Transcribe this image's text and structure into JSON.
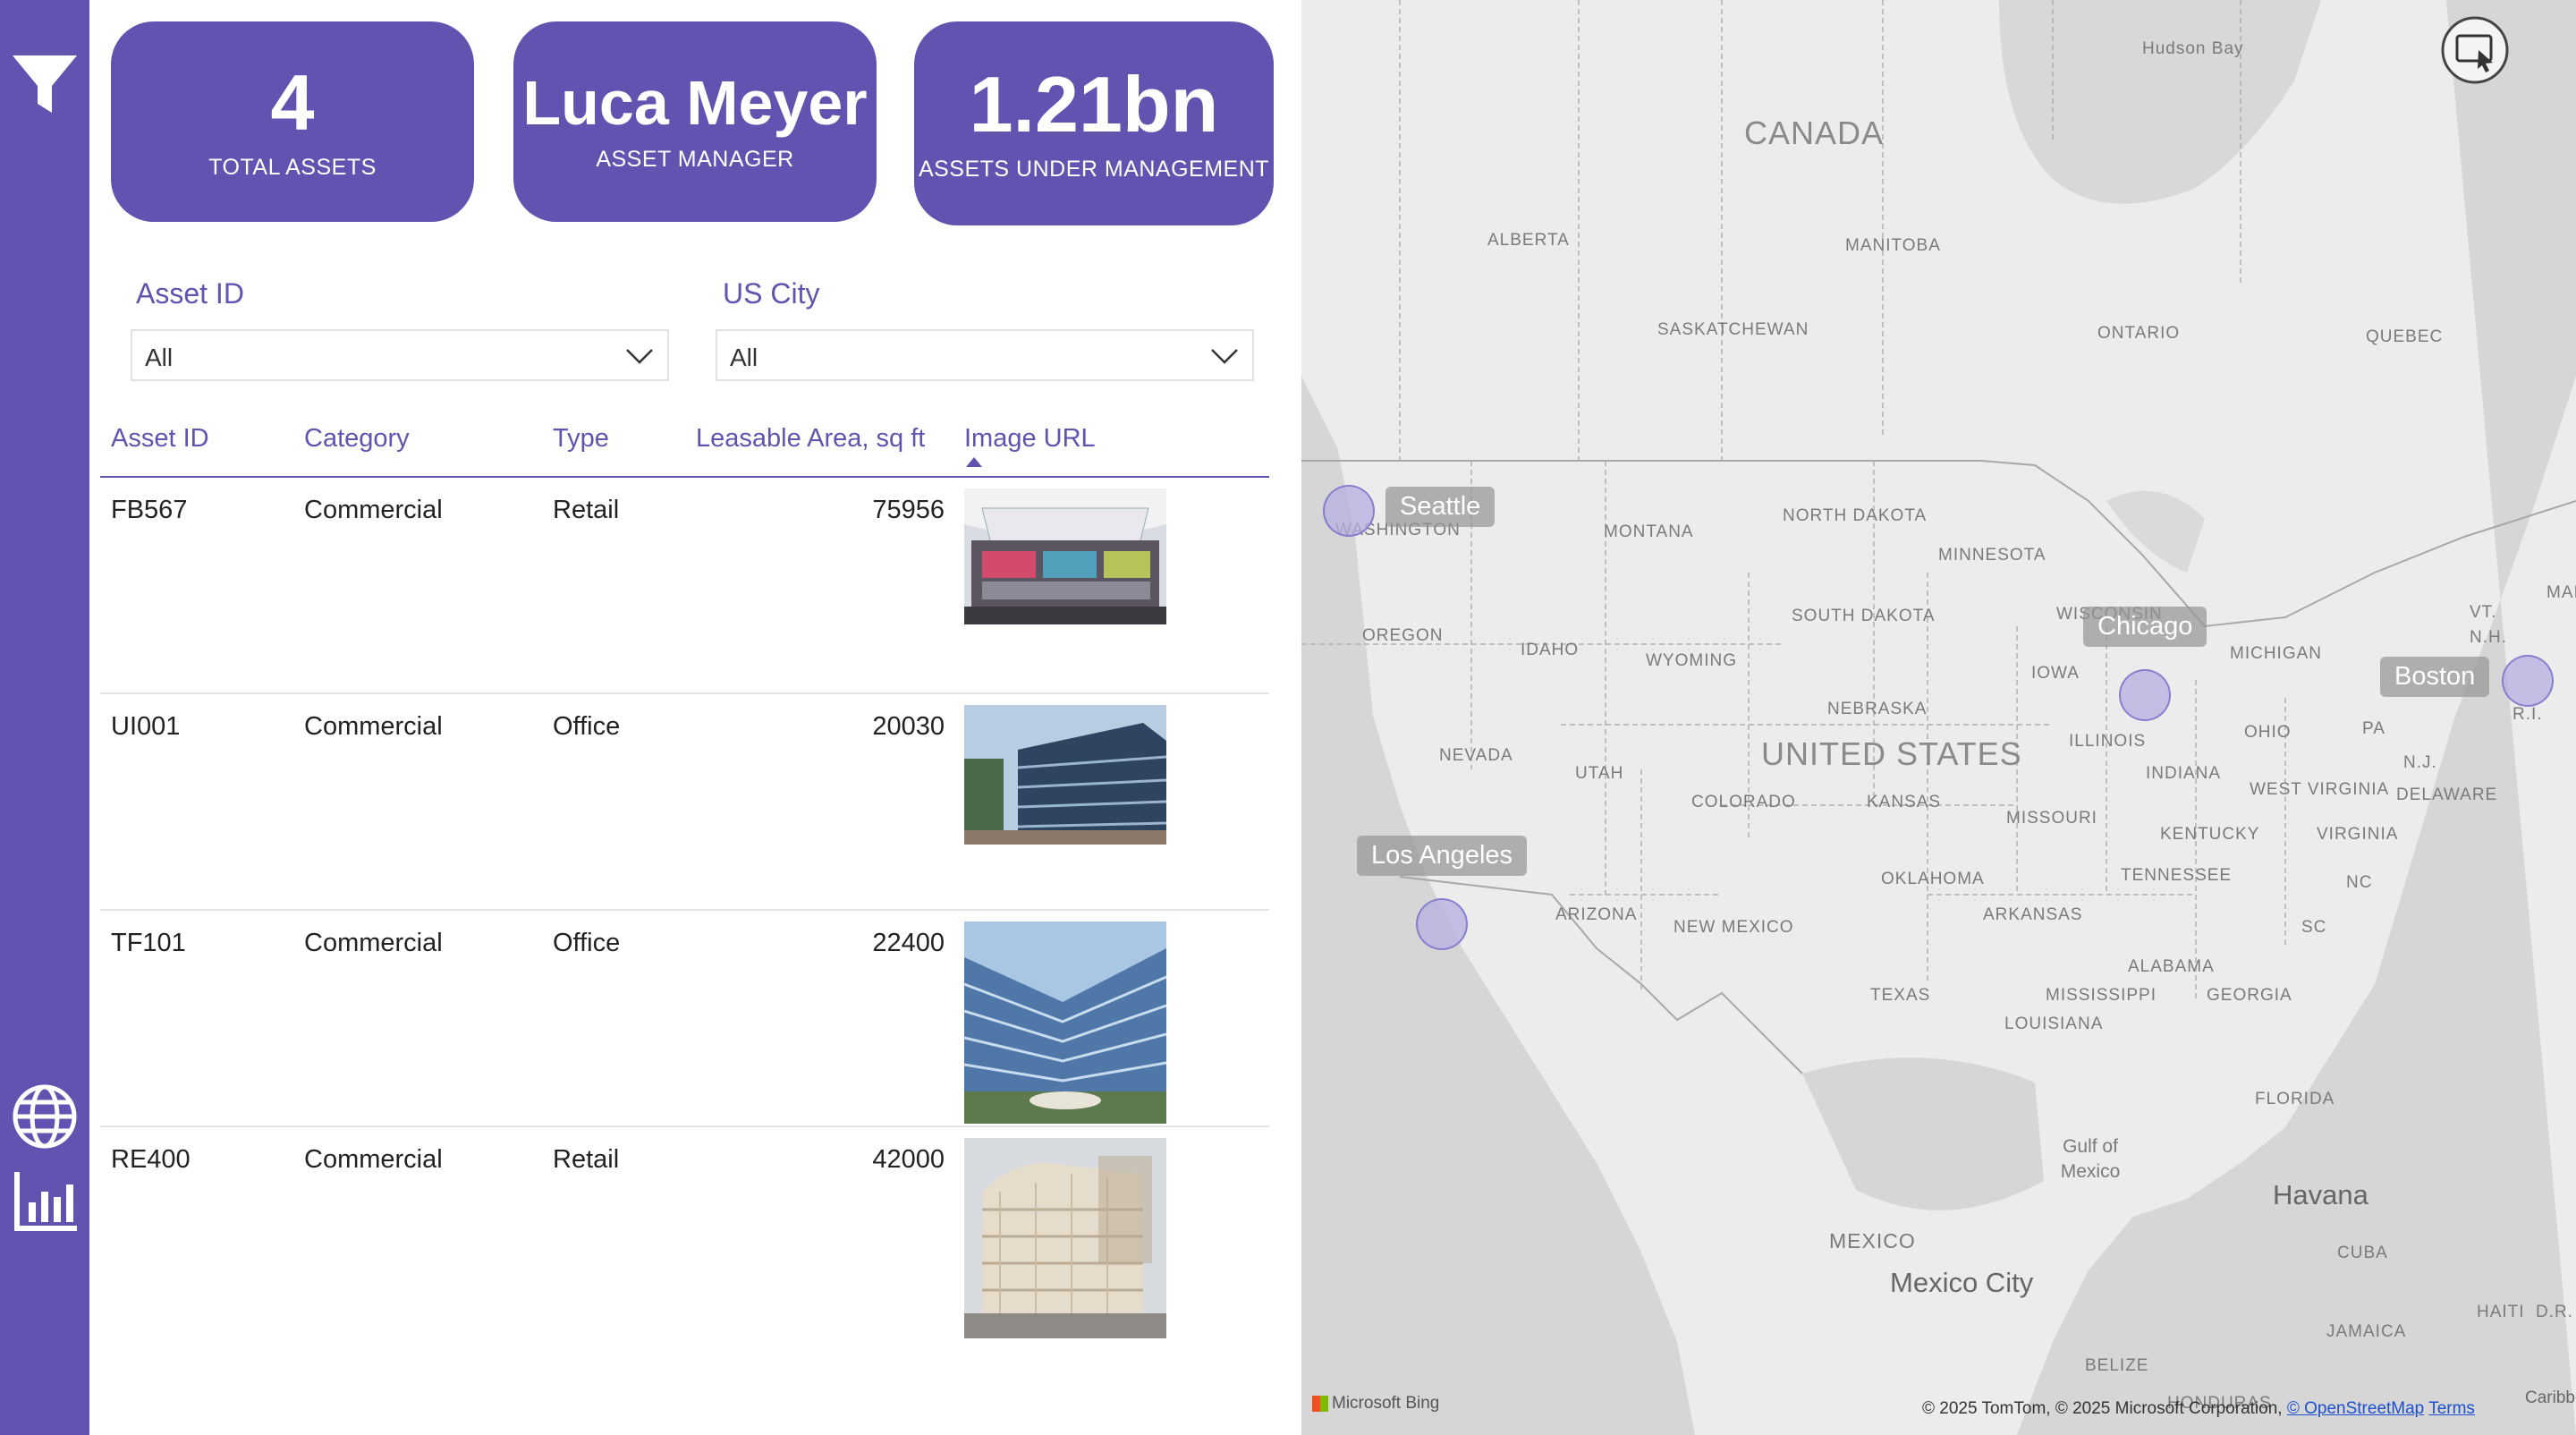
{
  "colors": {
    "accent": "#6153b0",
    "map_background": "#ececec",
    "bubble": "#b4afe1"
  },
  "rail": {
    "icons": [
      "filter-icon",
      "globe-icon",
      "bar-chart-icon"
    ]
  },
  "kpis": {
    "total_assets": {
      "value": "4",
      "label": "TOTAL ASSETS"
    },
    "asset_manager": {
      "value": "Luca Meyer",
      "label": "ASSET MANAGER"
    },
    "aum": {
      "value": "1.21bn",
      "label": "ASSETS UNDER MANAGEMENT"
    }
  },
  "slicers": {
    "asset_id": {
      "title": "Asset ID",
      "selected": "All"
    },
    "us_city": {
      "title": "US City",
      "selected": "All"
    }
  },
  "table": {
    "columns": [
      "Asset ID",
      "Category",
      "Type",
      "Leasable Area, sq ft",
      "Image URL"
    ],
    "sorted_column": "Image URL",
    "rows": [
      {
        "asset_id": "FB567",
        "category": "Commercial",
        "type": "Retail",
        "area": "75956",
        "image": "retail-building-photo"
      },
      {
        "asset_id": "UI001",
        "category": "Commercial",
        "type": "Office",
        "area": "20030",
        "image": "office-building-photo"
      },
      {
        "asset_id": "TF101",
        "category": "Commercial",
        "type": "Office",
        "area": "22400",
        "image": "office-building-photo"
      },
      {
        "asset_id": "RE400",
        "category": "Commercial",
        "type": "Retail",
        "area": "42000",
        "image": "retail-building-photo"
      }
    ]
  },
  "map": {
    "country_labels": [
      "CANADA",
      "UNITED STATES"
    ],
    "region_labels": [
      "Hudson Bay",
      "ALBERTA",
      "MANITOBA",
      "SASKATCHEWAN",
      "ONTARIO",
      "QUEBEC",
      "MONTANA",
      "NORTH DAKOTA",
      "MINNESOTA",
      "OREGON",
      "IDAHO",
      "WYOMING",
      "SOUTH DAKOTA",
      "WISCONSIN",
      "MICHIGAN",
      "IOWA",
      "NEBRASKA",
      "NEVADA",
      "UTAH",
      "COLORADO",
      "KANSAS",
      "ILLINOIS",
      "INDIANA",
      "OHIO",
      "PA",
      "MISSOURI",
      "KENTUCKY",
      "WEST VIRGINIA",
      "VIRGINIA",
      "DELAWARE",
      "N.J.",
      "VT.",
      "N.H.",
      "R.I.",
      "ARIZONA",
      "NEW MEXICO",
      "OKLAHOMA",
      "ARKANSAS",
      "TENNESSEE",
      "NC",
      "SC",
      "TEXAS",
      "ALABAMA",
      "MISSISSIPPI",
      "GEORGIA",
      "LOUISIANA",
      "FLORIDA",
      "Gulf of Mexico",
      "MEXICO",
      "CUBA",
      "HAITI",
      "D.R.",
      "JAMAICA",
      "BELIZE",
      "HONDURAS",
      "WASHINGTON",
      "MAI"
    ],
    "city_labels": [
      "Havana",
      "Mexico City"
    ],
    "bubbles": [
      {
        "city": "Seattle"
      },
      {
        "city": "Chicago"
      },
      {
        "city": "Boston"
      },
      {
        "city": "Los Angeles"
      }
    ],
    "attribution": {
      "logo": "Microsoft Bing",
      "text": "© 2025 TomTom, © 2025 Microsoft Corporation,",
      "osm": "© OpenStreetMap",
      "terms": "Terms",
      "caribbean": "Caribbean S"
    },
    "focus_mode_icon": "focus-mode-icon"
  }
}
